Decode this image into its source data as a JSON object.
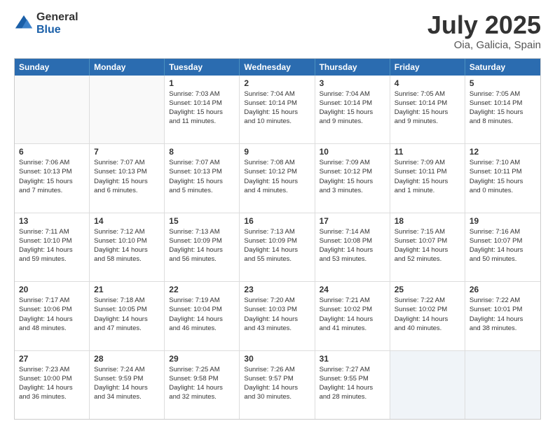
{
  "logo": {
    "general": "General",
    "blue": "Blue"
  },
  "header": {
    "title": "July 2025",
    "subtitle": "Oia, Galicia, Spain"
  },
  "days": [
    "Sunday",
    "Monday",
    "Tuesday",
    "Wednesday",
    "Thursday",
    "Friday",
    "Saturday"
  ],
  "weeks": [
    [
      {
        "day": "",
        "content": ""
      },
      {
        "day": "",
        "content": ""
      },
      {
        "day": "1",
        "content": "Sunrise: 7:03 AM\nSunset: 10:14 PM\nDaylight: 15 hours\nand 11 minutes."
      },
      {
        "day": "2",
        "content": "Sunrise: 7:04 AM\nSunset: 10:14 PM\nDaylight: 15 hours\nand 10 minutes."
      },
      {
        "day": "3",
        "content": "Sunrise: 7:04 AM\nSunset: 10:14 PM\nDaylight: 15 hours\nand 9 minutes."
      },
      {
        "day": "4",
        "content": "Sunrise: 7:05 AM\nSunset: 10:14 PM\nDaylight: 15 hours\nand 9 minutes."
      },
      {
        "day": "5",
        "content": "Sunrise: 7:05 AM\nSunset: 10:14 PM\nDaylight: 15 hours\nand 8 minutes."
      }
    ],
    [
      {
        "day": "6",
        "content": "Sunrise: 7:06 AM\nSunset: 10:13 PM\nDaylight: 15 hours\nand 7 minutes."
      },
      {
        "day": "7",
        "content": "Sunrise: 7:07 AM\nSunset: 10:13 PM\nDaylight: 15 hours\nand 6 minutes."
      },
      {
        "day": "8",
        "content": "Sunrise: 7:07 AM\nSunset: 10:13 PM\nDaylight: 15 hours\nand 5 minutes."
      },
      {
        "day": "9",
        "content": "Sunrise: 7:08 AM\nSunset: 10:12 PM\nDaylight: 15 hours\nand 4 minutes."
      },
      {
        "day": "10",
        "content": "Sunrise: 7:09 AM\nSunset: 10:12 PM\nDaylight: 15 hours\nand 3 minutes."
      },
      {
        "day": "11",
        "content": "Sunrise: 7:09 AM\nSunset: 10:11 PM\nDaylight: 15 hours\nand 1 minute."
      },
      {
        "day": "12",
        "content": "Sunrise: 7:10 AM\nSunset: 10:11 PM\nDaylight: 15 hours\nand 0 minutes."
      }
    ],
    [
      {
        "day": "13",
        "content": "Sunrise: 7:11 AM\nSunset: 10:10 PM\nDaylight: 14 hours\nand 59 minutes."
      },
      {
        "day": "14",
        "content": "Sunrise: 7:12 AM\nSunset: 10:10 PM\nDaylight: 14 hours\nand 58 minutes."
      },
      {
        "day": "15",
        "content": "Sunrise: 7:13 AM\nSunset: 10:09 PM\nDaylight: 14 hours\nand 56 minutes."
      },
      {
        "day": "16",
        "content": "Sunrise: 7:13 AM\nSunset: 10:09 PM\nDaylight: 14 hours\nand 55 minutes."
      },
      {
        "day": "17",
        "content": "Sunrise: 7:14 AM\nSunset: 10:08 PM\nDaylight: 14 hours\nand 53 minutes."
      },
      {
        "day": "18",
        "content": "Sunrise: 7:15 AM\nSunset: 10:07 PM\nDaylight: 14 hours\nand 52 minutes."
      },
      {
        "day": "19",
        "content": "Sunrise: 7:16 AM\nSunset: 10:07 PM\nDaylight: 14 hours\nand 50 minutes."
      }
    ],
    [
      {
        "day": "20",
        "content": "Sunrise: 7:17 AM\nSunset: 10:06 PM\nDaylight: 14 hours\nand 48 minutes."
      },
      {
        "day": "21",
        "content": "Sunrise: 7:18 AM\nSunset: 10:05 PM\nDaylight: 14 hours\nand 47 minutes."
      },
      {
        "day": "22",
        "content": "Sunrise: 7:19 AM\nSunset: 10:04 PM\nDaylight: 14 hours\nand 46 minutes."
      },
      {
        "day": "23",
        "content": "Sunrise: 7:20 AM\nSunset: 10:03 PM\nDaylight: 14 hours\nand 43 minutes."
      },
      {
        "day": "24",
        "content": "Sunrise: 7:21 AM\nSunset: 10:02 PM\nDaylight: 14 hours\nand 41 minutes."
      },
      {
        "day": "25",
        "content": "Sunrise: 7:22 AM\nSunset: 10:02 PM\nDaylight: 14 hours\nand 40 minutes."
      },
      {
        "day": "26",
        "content": "Sunrise: 7:22 AM\nSunset: 10:01 PM\nDaylight: 14 hours\nand 38 minutes."
      }
    ],
    [
      {
        "day": "27",
        "content": "Sunrise: 7:23 AM\nSunset: 10:00 PM\nDaylight: 14 hours\nand 36 minutes."
      },
      {
        "day": "28",
        "content": "Sunrise: 7:24 AM\nSunset: 9:59 PM\nDaylight: 14 hours\nand 34 minutes."
      },
      {
        "day": "29",
        "content": "Sunrise: 7:25 AM\nSunset: 9:58 PM\nDaylight: 14 hours\nand 32 minutes."
      },
      {
        "day": "30",
        "content": "Sunrise: 7:26 AM\nSunset: 9:57 PM\nDaylight: 14 hours\nand 30 minutes."
      },
      {
        "day": "31",
        "content": "Sunrise: 7:27 AM\nSunset: 9:55 PM\nDaylight: 14 hours\nand 28 minutes."
      },
      {
        "day": "",
        "content": ""
      },
      {
        "day": "",
        "content": ""
      }
    ]
  ]
}
